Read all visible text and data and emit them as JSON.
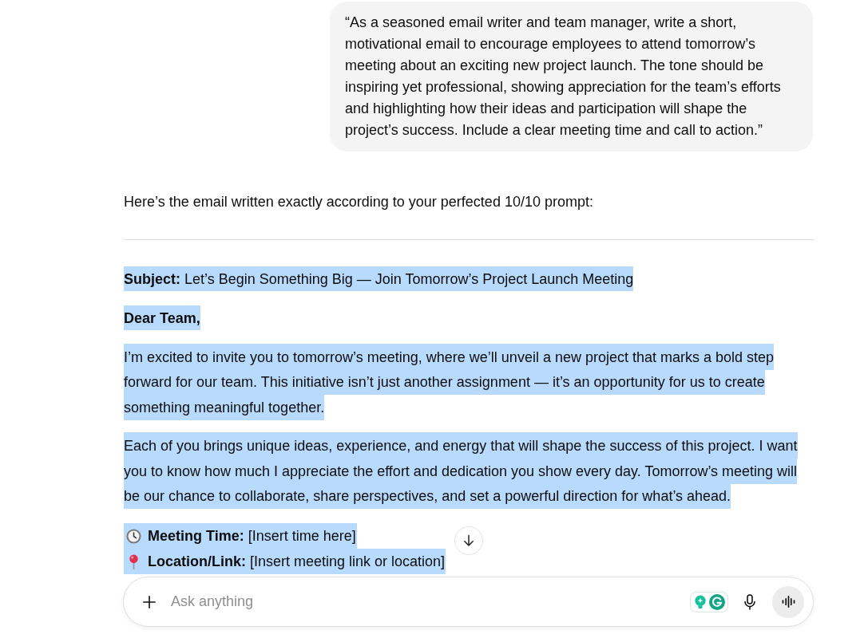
{
  "prompt_bubble": {
    "text": "“As a seasoned email writer and team manager, write a short, motivational email to encourage employees to attend tomorrow’s meeting about an exciting new project launch. The tone should be inspiring yet professional, showing appreciation for the team’s efforts and highlighting how their ideas and participation will shape the project’s success. Include a clear meeting time and call to action.”"
  },
  "reply": {
    "intro": "Here’s the email written exactly according to your perfected 10/10 prompt:",
    "email": {
      "subject": {
        "text": "**Subject:** Let’s Begin Something Big — Join Tomorrow’s Project Launch Meeting",
        "highlighted": true
      },
      "greeting": {
        "text": "Dear Team,",
        "highlighted": true
      },
      "paragraphs": [
        {
          "text": "I’m excited to invite you to tomorrow’s meeting, where we’ll unveil a new project that marks a bold step forward for our team. This initiative isn’t just another assignment — it’s an opportunity for us to create something meaningful together.",
          "highlighted": true
        },
        {
          "text": "Each of you brings unique ideas, experience, and energy that will shape the success of this project. I want you to know how much I appreciate the effort and dedication you show every day. Tomorrow’s meeting will be our chance to collaborate, share perspectives, and set a powerful direction for what’s ahead.",
          "highlighted": true
        }
      ],
      "details": [
        {
          "text": "**Meeting Time:** [Insert time here]",
          "highlighted": true
        },
        {
          "text": "**Location/Link:** [Insert meeting link or location]",
          "highlighted": true
        }
      ]
    }
  },
  "composer": {
    "placeholder": "Ask anything"
  }
}
